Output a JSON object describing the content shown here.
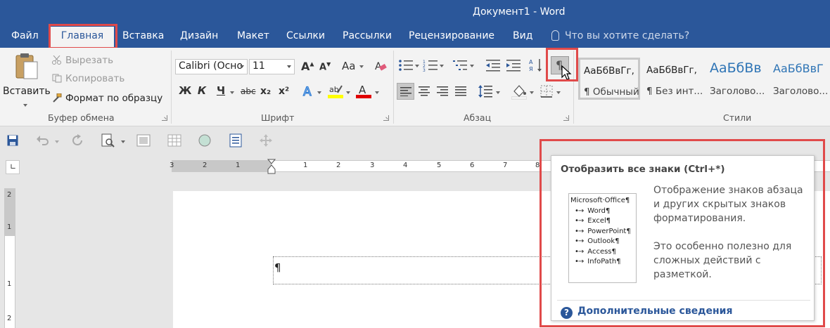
{
  "window": {
    "title": "Документ1 - Word"
  },
  "tabs": [
    {
      "label": "Файл"
    },
    {
      "label": "Главная"
    },
    {
      "label": "Вставка"
    },
    {
      "label": "Дизайн"
    },
    {
      "label": "Макет"
    },
    {
      "label": "Ссылки"
    },
    {
      "label": "Рассылки"
    },
    {
      "label": "Рецензирование"
    },
    {
      "label": "Вид"
    }
  ],
  "tell_me": {
    "placeholder": "Что вы хотите сделать?"
  },
  "clipboard": {
    "paste": "Вставить",
    "cut": "Вырезать",
    "copy": "Копировать",
    "format_painter": "Формат по образцу",
    "group": "Буфер обмена"
  },
  "font": {
    "name": "Calibri (Осно",
    "size": "11",
    "group": "Шрифт",
    "bold": "Ж",
    "italic": "К",
    "underline": "Ч",
    "strike": "abc",
    "subscript": "x₂",
    "superscript": "x²",
    "case": "Aa",
    "grow": "A",
    "shrink": "A"
  },
  "paragraph": {
    "group": "Абзац",
    "show_marks": "¶"
  },
  "styles": {
    "group": "Стили",
    "items": [
      {
        "sample": "АаБбВвГг,",
        "name": "¶ Обычный"
      },
      {
        "sample": "АаБбВвГг,",
        "name": "¶ Без инт..."
      },
      {
        "sample": "АаБбВв",
        "name": "Заголово..."
      },
      {
        "sample": "АаБбВвГ",
        "name": "Заголово..."
      }
    ]
  },
  "ruler": {
    "h_labels": [
      "3",
      "2",
      "1",
      "1",
      "2",
      "3",
      "4",
      "5",
      "6",
      "7",
      "8"
    ],
    "v_labels": [
      "2",
      "1",
      "1",
      "2"
    ]
  },
  "document": {
    "mark": "¶"
  },
  "tooltip": {
    "title": "Отобразить все знаки (Ctrl+*)",
    "preview_heading": "Microsoft·Office¶",
    "preview_items": [
      "Word¶",
      "Excel¶",
      "PowerPoint¶",
      "Outlook¶",
      "Access¶",
      "InfoPath¶"
    ],
    "preview_arrow": "•→",
    "paragraph1": "Отображение знаков абзаца и других скрытых знаков форматирования.",
    "paragraph2": "Это особенно полезно для сложных действий с разметкой.",
    "link": "Дополнительные сведения",
    "link_icon": "?"
  },
  "colors": {
    "accent": "#2b579a",
    "highlight_red": "#e04a4a",
    "highlight_yellow": "#ffff00",
    "font_color_red": "#e00000"
  }
}
